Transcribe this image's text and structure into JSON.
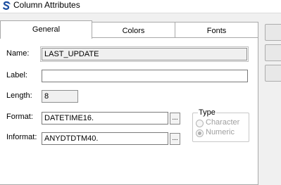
{
  "window": {
    "title": "Column Attributes",
    "icon": "sas-s-logo-icon"
  },
  "tabs": [
    {
      "label": "General",
      "active": true
    },
    {
      "label": "Colors",
      "active": false
    },
    {
      "label": "Fonts",
      "active": false
    }
  ],
  "fields": {
    "name": {
      "label": "Name:",
      "value": "LAST_UPDATE"
    },
    "label": {
      "label": "Label:",
      "value": ""
    },
    "length": {
      "label": "Length:",
      "value": "8"
    },
    "format": {
      "label": "Format:",
      "value": "DATETIME16.",
      "button": "..."
    },
    "informat": {
      "label": "Informat:",
      "value": "ANYDTDTM40.",
      "button": "..."
    }
  },
  "type_group": {
    "title": "Type",
    "options": [
      {
        "label": "Character",
        "checked": false
      },
      {
        "label": "Numeric",
        "checked": true
      }
    ]
  },
  "colors": {
    "accent": "#1c4ea0",
    "disabled_text": "#a0a0a0"
  }
}
